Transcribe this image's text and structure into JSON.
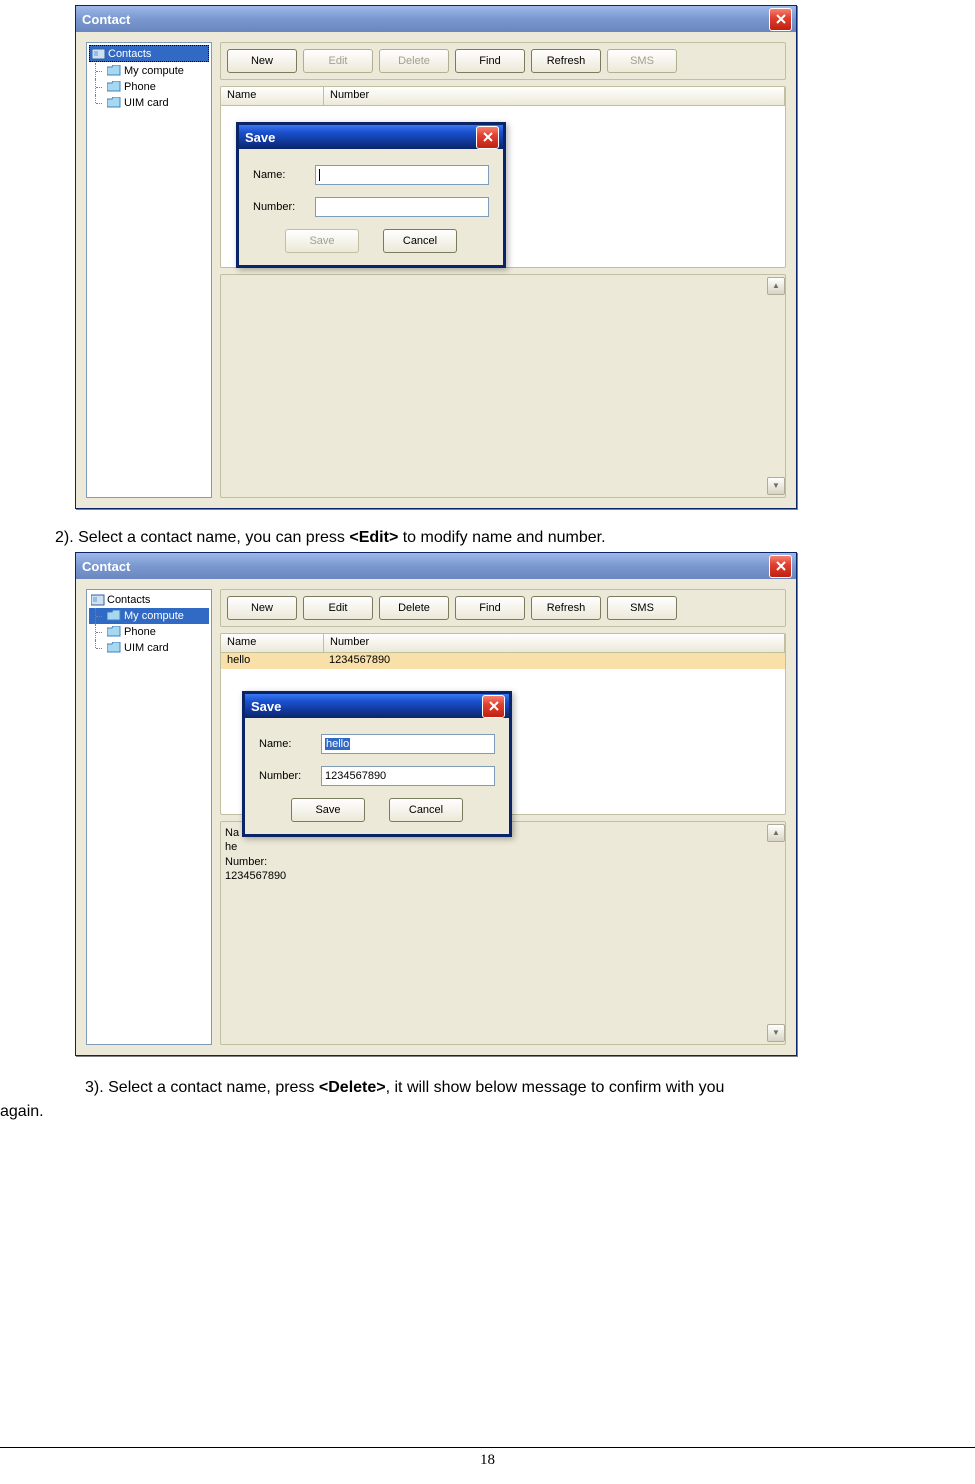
{
  "screenshots": {
    "s1": {
      "window_title": "Contact",
      "tree": {
        "root": "Contacts",
        "root_selected": true,
        "children": [
          {
            "label": "My compute",
            "selected": false
          },
          {
            "label": "Phone",
            "selected": false
          },
          {
            "label": "UIM card",
            "selected": false
          }
        ]
      },
      "toolbar": [
        {
          "label": "New",
          "disabled": false
        },
        {
          "label": "Edit",
          "disabled": true
        },
        {
          "label": "Delete",
          "disabled": true
        },
        {
          "label": "Find",
          "disabled": false
        },
        {
          "label": "Refresh",
          "disabled": false
        },
        {
          "label": "SMS",
          "disabled": true
        }
      ],
      "list_headers": {
        "name": "Name",
        "number": "Number"
      },
      "save_dialog": {
        "title": "Save",
        "name_label": "Name:",
        "number_label": "Number:",
        "name_value": "",
        "number_value": "",
        "save_btn": "Save",
        "save_disabled": true,
        "cancel_btn": "Cancel"
      }
    },
    "s2": {
      "window_title": "Contact",
      "tree": {
        "root": "Contacts",
        "root_selected": false,
        "children": [
          {
            "label": "My compute",
            "selected": true
          },
          {
            "label": "Phone",
            "selected": false
          },
          {
            "label": "UIM card",
            "selected": false
          }
        ]
      },
      "toolbar": [
        {
          "label": "New",
          "disabled": false
        },
        {
          "label": "Edit",
          "disabled": false
        },
        {
          "label": "Delete",
          "disabled": false
        },
        {
          "label": "Find",
          "disabled": false
        },
        {
          "label": "Refresh",
          "disabled": false
        },
        {
          "label": "SMS",
          "disabled": false
        }
      ],
      "list_headers": {
        "name": "Name",
        "number": "Number"
      },
      "list_rows": [
        {
          "name": "hello",
          "number": "1234567890",
          "selected": true
        }
      ],
      "detail": {
        "name_label": "Na",
        "name_value": "he",
        "number_label": "Number:",
        "number_value": "1234567890"
      },
      "save_dialog": {
        "title": "Save",
        "name_label": "Name:",
        "number_label": "Number:",
        "name_value": "hello",
        "name_selected": true,
        "number_value": "1234567890",
        "save_btn": "Save",
        "save_disabled": false,
        "cancel_btn": "Cancel"
      }
    }
  },
  "doc": {
    "caption2_prefix": "2). Select a contact name, you can press ",
    "caption2_bold": "<Edit>",
    "caption2_suffix": " to modify name and number.",
    "caption3_prefix": "3). Select a contact name, press ",
    "caption3_bold": "<Delete>",
    "caption3_suffix": ", it will show below message to confirm with you",
    "caption3_line2": "again.",
    "page_number": "18"
  }
}
